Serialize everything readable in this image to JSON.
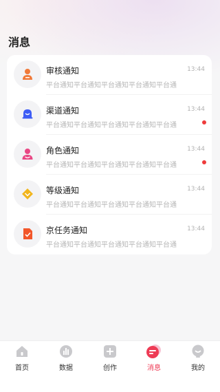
{
  "page": {
    "title": "消息"
  },
  "notifications": [
    {
      "title": "审核通知",
      "time": "13:44",
      "preview": "平台通知平台通知平台通知平台通知平台通",
      "unread": false,
      "icon": "person-icon",
      "color": "#f07a3a"
    },
    {
      "title": "渠道通知",
      "time": "13:44",
      "preview": "平台通知平台通知平台通知平台通知平台通",
      "unread": true,
      "icon": "bell-icon",
      "color": "#3d5cf5"
    },
    {
      "title": "角色通知",
      "time": "13:44",
      "preview": "平台通知平台通知平台通知平台通知平台通",
      "unread": true,
      "icon": "user-icon",
      "color": "#e94784"
    },
    {
      "title": "等级通知",
      "time": "13:44",
      "preview": "平台通知平台通知平台通知平台通知平台通",
      "unread": false,
      "icon": "diamond-icon",
      "color": "#f1b51d"
    },
    {
      "title": "京任务通知",
      "time": "13:44",
      "preview": "平台通知平台通知平台通知平台通知平台通",
      "unread": false,
      "icon": "document-icon",
      "color": "#f2562a"
    }
  ],
  "tabbar": [
    {
      "label": "首页",
      "icon": "home-icon",
      "active": false
    },
    {
      "label": "数据",
      "icon": "chart-icon",
      "active": false
    },
    {
      "label": "创作",
      "icon": "plus-icon",
      "active": false
    },
    {
      "label": "消息",
      "icon": "message-icon",
      "active": true
    },
    {
      "label": "我的",
      "icon": "profile-icon",
      "active": false
    }
  ],
  "colors": {
    "accent": "#ee3b55",
    "unread_dot": "#ee3b3b"
  }
}
